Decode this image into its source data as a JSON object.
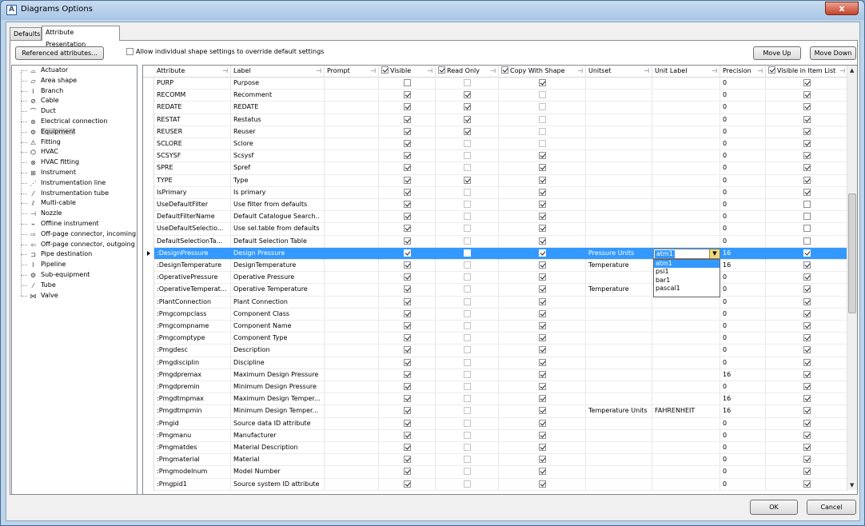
{
  "window": {
    "title": "Diagrams Options",
    "close_label": "x"
  },
  "tabs": [
    {
      "label": "Defaults"
    },
    {
      "label": "Attribute Presentation"
    }
  ],
  "toolbar": {
    "referenced_label": "Referenced attributes...",
    "override_label": "Allow individual shape settings to override default settings",
    "override_checked": false,
    "move_up_label": "Move Up",
    "move_down_label": "Move Down"
  },
  "tree": {
    "items": [
      {
        "label": "Actuator",
        "icon": "actuator-icon",
        "glyph": "⌓"
      },
      {
        "label": "Area shape",
        "icon": "area-shape-icon",
        "glyph": "▱"
      },
      {
        "label": "Branch",
        "icon": "branch-icon",
        "glyph": "⌇"
      },
      {
        "label": "Cable",
        "icon": "cable-icon",
        "glyph": "⊘"
      },
      {
        "label": "Duct",
        "icon": "duct-icon",
        "glyph": "⌒"
      },
      {
        "label": "Electrical connection",
        "icon": "electrical-icon",
        "glyph": "⊛"
      },
      {
        "label": "Equipment",
        "icon": "equipment-icon",
        "glyph": "⚙"
      },
      {
        "label": "Fitting",
        "icon": "fitting-icon",
        "glyph": "⚠"
      },
      {
        "label": "HVAC",
        "icon": "hvac-icon",
        "glyph": "⌬"
      },
      {
        "label": "HVAC fitting",
        "icon": "hvac-fitting-icon",
        "glyph": "⊗"
      },
      {
        "label": "Instrument",
        "icon": "instrument-icon",
        "glyph": "⊞"
      },
      {
        "label": "Instrumentation line",
        "icon": "instrumentation-line-icon",
        "glyph": "⋰"
      },
      {
        "label": "Instrumentation tube",
        "icon": "instrumentation-tube-icon",
        "glyph": "⁄"
      },
      {
        "label": "Multi-cable",
        "icon": "multi-cable-icon",
        "glyph": "⫽"
      },
      {
        "label": "Nozzle",
        "icon": "nozzle-icon",
        "glyph": "⊣"
      },
      {
        "label": "Offline instrument",
        "icon": "offline-instrument-icon",
        "glyph": "⌁"
      },
      {
        "label": "Off-page connector, incoming",
        "icon": "offpage-in-icon",
        "glyph": "⇨"
      },
      {
        "label": "Off-page connector, outgoing",
        "icon": "offpage-out-icon",
        "glyph": "⇦"
      },
      {
        "label": "Pipe destination",
        "icon": "pipe-destination-icon",
        "glyph": "⊐"
      },
      {
        "label": "Pipeline",
        "icon": "pipeline-icon",
        "glyph": "⌇"
      },
      {
        "label": "Sub-equipment",
        "icon": "sub-equipment-icon",
        "glyph": "⚙"
      },
      {
        "label": "Tube",
        "icon": "tube-icon",
        "glyph": "⁄"
      },
      {
        "label": "Valve",
        "icon": "valve-icon",
        "glyph": "⋈"
      }
    ],
    "selected": "Equipment"
  },
  "grid": {
    "columns": {
      "attribute": "Attribute",
      "label": "Label",
      "prompt": "Prompt",
      "visible": "Visible",
      "readonly": "Read Only",
      "copy": "Copy With Shape",
      "unitset": "Unitset",
      "unitlabel": "Unit Label",
      "precision": "Precision",
      "itemlist": "Visible in Item List"
    },
    "rows": [
      {
        "attr": "PURP",
        "label": "Purpose",
        "prompt": "",
        "visible": false,
        "readonly": false,
        "copy": true,
        "unitset": "",
        "unitlabel": "",
        "precision": "0",
        "itemlist": true
      },
      {
        "attr": "RECOMM",
        "label": "Recomment",
        "prompt": "",
        "visible": true,
        "readonly": true,
        "copy": false,
        "unitset": "",
        "unitlabel": "",
        "precision": "0",
        "itemlist": true
      },
      {
        "attr": "REDATE",
        "label": "REDATE",
        "prompt": "",
        "visible": true,
        "readonly": true,
        "copy": false,
        "unitset": "",
        "unitlabel": "",
        "precision": "0",
        "itemlist": true
      },
      {
        "attr": "RESTAT",
        "label": "Restatus",
        "prompt": "",
        "visible": true,
        "readonly": true,
        "copy": false,
        "unitset": "",
        "unitlabel": "",
        "precision": "0",
        "itemlist": true
      },
      {
        "attr": "REUSER",
        "label": "Reuser",
        "prompt": "",
        "visible": true,
        "readonly": true,
        "copy": false,
        "unitset": "",
        "unitlabel": "",
        "precision": "0",
        "itemlist": true
      },
      {
        "attr": "SCLORE",
        "label": "Sclore",
        "prompt": "",
        "visible": true,
        "readonly": false,
        "copy": false,
        "unitset": "",
        "unitlabel": "",
        "precision": "0",
        "itemlist": true
      },
      {
        "attr": "SCSYSF",
        "label": "Scsysf",
        "prompt": "",
        "visible": true,
        "readonly": false,
        "copy": true,
        "unitset": "",
        "unitlabel": "",
        "precision": "0",
        "itemlist": true
      },
      {
        "attr": "SPRE",
        "label": "Spref",
        "prompt": "",
        "visible": true,
        "readonly": false,
        "copy": true,
        "unitset": "",
        "unitlabel": "",
        "precision": "0",
        "itemlist": true
      },
      {
        "attr": "TYPE",
        "label": "Type",
        "prompt": "",
        "visible": true,
        "readonly": true,
        "copy": true,
        "unitset": "",
        "unitlabel": "",
        "precision": "0",
        "itemlist": true
      },
      {
        "attr": "IsPrimary",
        "label": "Is primary",
        "prompt": "",
        "visible": true,
        "readonly": false,
        "copy": true,
        "unitset": "",
        "unitlabel": "",
        "precision": "0",
        "itemlist": true
      },
      {
        "attr": "UseDefaultFilter",
        "label": "Use filter from defaults",
        "prompt": "",
        "visible": true,
        "readonly": false,
        "copy": true,
        "unitset": "",
        "unitlabel": "",
        "precision": "0",
        "itemlist": false
      },
      {
        "attr": "DefaultFilterName",
        "label": "Default Catalogue Search..",
        "prompt": "",
        "visible": true,
        "readonly": false,
        "copy": true,
        "unitset": "",
        "unitlabel": "",
        "precision": "0",
        "itemlist": false
      },
      {
        "attr": "UseDefaultSelectio...",
        "label": "Use sel.table from defaults",
        "prompt": "",
        "visible": true,
        "readonly": false,
        "copy": true,
        "unitset": "",
        "unitlabel": "",
        "precision": "0",
        "itemlist": false
      },
      {
        "attr": "DefaultSelectionTa...",
        "label": "Default Selection Table",
        "prompt": "",
        "visible": true,
        "readonly": false,
        "copy": true,
        "unitset": "",
        "unitlabel": "",
        "precision": "0",
        "itemlist": false
      },
      {
        "attr": ":DesignPressure",
        "label": "Design Pressure",
        "prompt": "",
        "visible": true,
        "readonly": false,
        "copy": true,
        "unitset": "Pressure Units",
        "unitlabel": "atm1",
        "precision": "16",
        "itemlist": true,
        "selected": true
      },
      {
        "attr": ":DesignTemperature",
        "label": "DesignTemperature",
        "prompt": "",
        "visible": true,
        "readonly": false,
        "copy": true,
        "unitset": "Temperature",
        "unitlabel": "",
        "precision": "16",
        "itemlist": true
      },
      {
        "attr": ":OperativePressure",
        "label": "Operative Pressure",
        "prompt": "",
        "visible": true,
        "readonly": false,
        "copy": true,
        "unitset": "",
        "unitlabel": "",
        "precision": "0",
        "itemlist": true
      },
      {
        "attr": ":OperativeTemperat...",
        "label": "Operative Temperature",
        "prompt": "",
        "visible": true,
        "readonly": false,
        "copy": true,
        "unitset": "Temperature",
        "unitlabel": "",
        "precision": "0",
        "itemlist": true
      },
      {
        "attr": ":PlantConnection",
        "label": "Plant Connection",
        "prompt": "",
        "visible": true,
        "readonly": false,
        "copy": true,
        "unitset": "",
        "unitlabel": "",
        "precision": "0",
        "itemlist": true
      },
      {
        "attr": ":Pmgcompclass",
        "label": "Component Class",
        "prompt": "",
        "visible": true,
        "readonly": false,
        "copy": true,
        "unitset": "",
        "unitlabel": "",
        "precision": "0",
        "itemlist": true
      },
      {
        "attr": ":Pmgcompname",
        "label": "Component Name",
        "prompt": "",
        "visible": true,
        "readonly": false,
        "copy": true,
        "unitset": "",
        "unitlabel": "",
        "precision": "0",
        "itemlist": true
      },
      {
        "attr": ":Pmgcomptype",
        "label": "Component Type",
        "prompt": "",
        "visible": true,
        "readonly": false,
        "copy": true,
        "unitset": "",
        "unitlabel": "",
        "precision": "0",
        "itemlist": true
      },
      {
        "attr": ":Pmgdesc",
        "label": "Description",
        "prompt": "",
        "visible": true,
        "readonly": false,
        "copy": true,
        "unitset": "",
        "unitlabel": "",
        "precision": "0",
        "itemlist": true
      },
      {
        "attr": ":Pmgdisciplin",
        "label": "Discipline",
        "prompt": "",
        "visible": true,
        "readonly": false,
        "copy": true,
        "unitset": "",
        "unitlabel": "",
        "precision": "0",
        "itemlist": true
      },
      {
        "attr": ":Pmgdpremax",
        "label": "Maximum Design Pressure",
        "prompt": "",
        "visible": true,
        "readonly": false,
        "copy": true,
        "unitset": "",
        "unitlabel": "",
        "precision": "16",
        "itemlist": true
      },
      {
        "attr": ":Pmgdpremin",
        "label": "Minimum Design Pressure",
        "prompt": "",
        "visible": true,
        "readonly": false,
        "copy": true,
        "unitset": "",
        "unitlabel": "",
        "precision": "0",
        "itemlist": true
      },
      {
        "attr": ":Pmgdtmpmax",
        "label": "Maximum Design Temper...",
        "prompt": "",
        "visible": true,
        "readonly": false,
        "copy": true,
        "unitset": "",
        "unitlabel": "",
        "precision": "16",
        "itemlist": true
      },
      {
        "attr": ":Pmgdtmpmin",
        "label": "Minimum Design Temper...",
        "prompt": "",
        "visible": true,
        "readonly": false,
        "copy": true,
        "unitset": "Temperature Units",
        "unitlabel": "FAHRENHEIT",
        "precision": "16",
        "itemlist": true
      },
      {
        "attr": ":Pmgid",
        "label": "Source data ID attribute",
        "prompt": "",
        "visible": true,
        "readonly": false,
        "copy": true,
        "unitset": "",
        "unitlabel": "",
        "precision": "0",
        "itemlist": true
      },
      {
        "attr": ":Pmgmanu",
        "label": "Manufacturer",
        "prompt": "",
        "visible": true,
        "readonly": false,
        "copy": true,
        "unitset": "",
        "unitlabel": "",
        "precision": "0",
        "itemlist": true
      },
      {
        "attr": ":Pmgmatdes",
        "label": "Material Description",
        "prompt": "",
        "visible": true,
        "readonly": false,
        "copy": true,
        "unitset": "",
        "unitlabel": "",
        "precision": "0",
        "itemlist": true
      },
      {
        "attr": ":Pmgmaterial",
        "label": "Material",
        "prompt": "",
        "visible": true,
        "readonly": false,
        "copy": true,
        "unitset": "",
        "unitlabel": "",
        "precision": "0",
        "itemlist": true
      },
      {
        "attr": ":Pmgmodelnum",
        "label": "Model Number",
        "prompt": "",
        "visible": true,
        "readonly": false,
        "copy": true,
        "unitset": "",
        "unitlabel": "",
        "precision": "0",
        "itemlist": true
      },
      {
        "attr": ":Pmgpid1",
        "label": "Source system ID attribute",
        "prompt": "",
        "visible": true,
        "readonly": false,
        "copy": true,
        "unitset": "",
        "unitlabel": "",
        "precision": "0",
        "itemlist": true
      }
    ]
  },
  "unit_dropdown": {
    "value": "atm1",
    "options": [
      "atm1",
      "psi1",
      "bar1",
      "pascal1"
    ]
  },
  "footer": {
    "ok_label": "OK",
    "cancel_label": "Cancel"
  },
  "colors": {
    "selection": "#3399ff",
    "dropdown_button": "#f0d77a"
  }
}
